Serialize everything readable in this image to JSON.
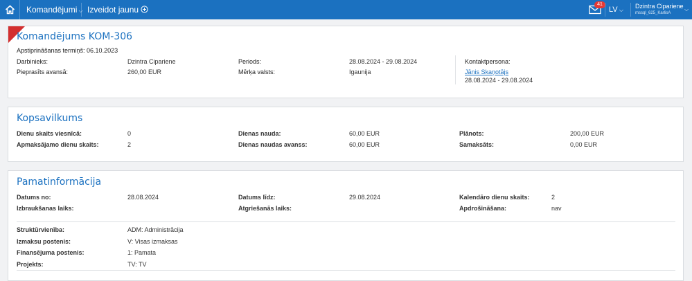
{
  "nav": {
    "menu_label": "Komandējumi",
    "create_label": "Izveidot jaunu",
    "mail_count": "41",
    "lang": "LV",
    "user_name": "Dzintra Cipariene",
    "user_sub": "mssql_625_KarlisA"
  },
  "header": {
    "title": "Komandējums KOM-306",
    "approval": "Apstiprināšanas termiņš: 06.10.2023",
    "employee_label": "Darbinieks:",
    "employee_value": "Dzintra Cipariene",
    "advance_label": "Pieprasīts avansā:",
    "advance_value": "260,00 EUR",
    "period_label": "Periods:",
    "period_value": "28.08.2024 - 29.08.2024",
    "country_label": "Mērķa valsts:",
    "country_value": "Igaunija",
    "contact_label": "Kontaktpersona:",
    "contact_name": "Jānis Skaņotājs",
    "contact_period": "28.08.2024 - 29.08.2024"
  },
  "summary": {
    "title": "Kopsavilkums",
    "hotel_days_label": "Dienu skaits viesnīcā:",
    "hotel_days_value": "0",
    "paid_days_label": "Apmaksājamo dienu skaits:",
    "paid_days_value": "2",
    "daily_label": "Dienas nauda:",
    "daily_value": "60,00 EUR",
    "daily_adv_label": "Dienas naudas avanss:",
    "daily_adv_value": "60,00 EUR",
    "planned_label": "Plānots:",
    "planned_value": "200,00 EUR",
    "paid_label": "Samaksāts:",
    "paid_value": "0,00 EUR"
  },
  "basic": {
    "title": "Pamatinformācija",
    "date_from_label": "Datums no:",
    "date_from_value": "28.08.2024",
    "depart_label": "Izbraukšanas laiks:",
    "date_to_label": "Datums līdz:",
    "date_to_value": "29.08.2024",
    "return_label": "Atgriešanās laiks:",
    "cal_days_label": "Kalendāro dienu skaits:",
    "cal_days_value": "2",
    "insurance_label": "Apdrošināšana:",
    "insurance_value": "nav",
    "unit_label": "Struktūrvienība:",
    "unit_value": "ADM: Administrācija",
    "expense_label": "Izmaksu postenis:",
    "expense_value": "V: Visas izmaksas",
    "finance_label": "Finansējuma postenis:",
    "finance_value": "1: Pamata",
    "project_label": "Projekts:",
    "project_value": "TV: TV"
  }
}
